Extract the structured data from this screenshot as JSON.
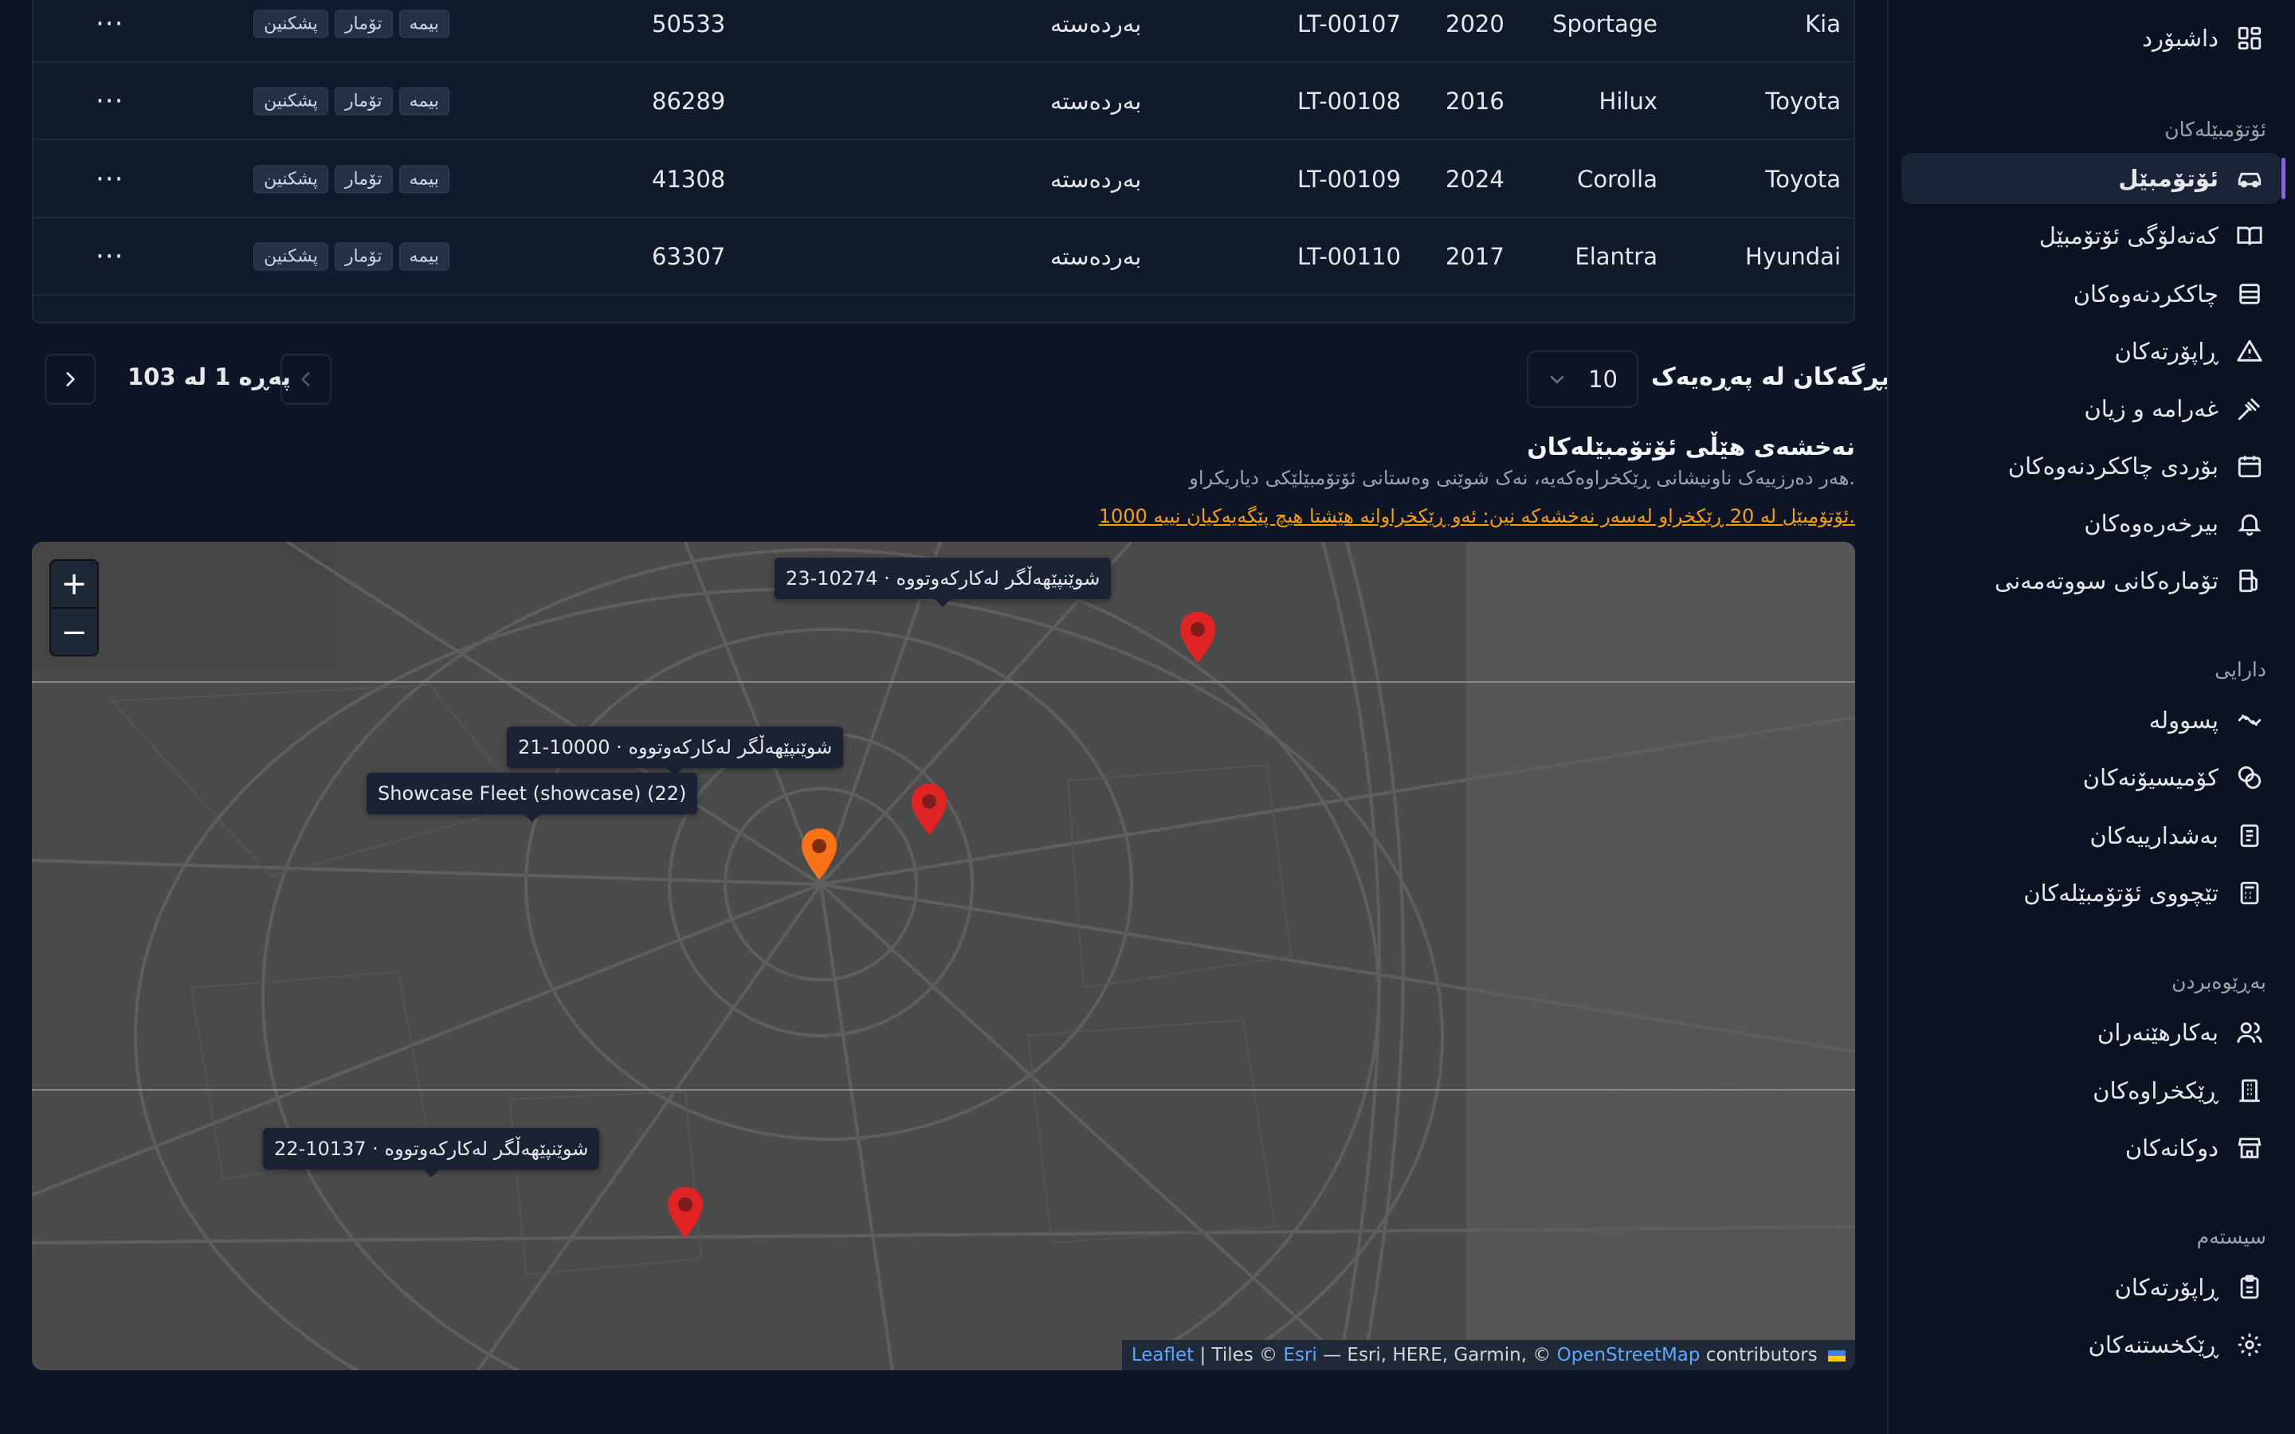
{
  "sidebar": {
    "dashboard": "داشبۆرد",
    "sections": {
      "vehicles": "ئۆتۆمبێلەکان",
      "finance": "دارایی",
      "management": "بەڕێوەبردن",
      "system": "سیستەم"
    },
    "vehicle_items": [
      {
        "label": "ئۆتۆمبێل",
        "icon": "car-icon",
        "active": true
      },
      {
        "label": "کەتەلۆگی ئۆتۆمبێل",
        "icon": "book-icon"
      },
      {
        "label": "چاککردنەوەکان",
        "icon": "wrench-icon"
      },
      {
        "label": "ڕاپۆرتەکان",
        "icon": "warning-icon"
      },
      {
        "label": "غەرامە و زیان",
        "icon": "gavel-icon"
      },
      {
        "label": "بۆردی چاککردنەوەکان",
        "icon": "calendar-icon"
      },
      {
        "label": "بیرخەرەوەکان",
        "icon": "bell-icon"
      },
      {
        "label": "تۆمارەکانی سووتەمەنی",
        "icon": "fuel-icon"
      }
    ],
    "finance_items": [
      {
        "label": "پسوولە",
        "icon": "receipt-icon"
      },
      {
        "label": "کۆمیسیۆنەکان",
        "icon": "coins-icon"
      },
      {
        "label": "بەشدارییەکان",
        "icon": "document-icon"
      },
      {
        "label": "تێچووی ئۆتۆمبێلەکان",
        "icon": "calculator-icon"
      }
    ],
    "management_items": [
      {
        "label": "بەکارهێنەران",
        "icon": "users-icon"
      },
      {
        "label": "ڕێکخراوەکان",
        "icon": "building-icon"
      },
      {
        "label": "دوکانەکان",
        "icon": "store-icon"
      }
    ],
    "system_items": [
      {
        "label": "ڕاپۆرتەکان",
        "icon": "clipboard-icon"
      },
      {
        "label": "ڕێکخستنەکان",
        "icon": "gear-icon"
      }
    ]
  },
  "table": {
    "rows": [
      {
        "make": "Kia",
        "model": "Sportage",
        "year": "2020",
        "plate": "LT-00107",
        "status": "بەردەستە",
        "mileage": "50533",
        "tags": [
          "بیمە",
          "تۆمار",
          "پشکنین"
        ]
      },
      {
        "make": "Toyota",
        "model": "Hilux",
        "year": "2016",
        "plate": "LT-00108",
        "status": "بەردەستە",
        "mileage": "86289",
        "tags": [
          "بیمە",
          "تۆمار",
          "پشکنین"
        ]
      },
      {
        "make": "Toyota",
        "model": "Corolla",
        "year": "2024",
        "plate": "LT-00109",
        "status": "بەردەستە",
        "mileage": "41308",
        "tags": [
          "بیمە",
          "تۆمار",
          "پشکنین"
        ]
      },
      {
        "make": "Hyundai",
        "model": "Elantra",
        "year": "2017",
        "plate": "LT-00110",
        "status": "بەردەستە",
        "mileage": "63307",
        "tags": [
          "بیمە",
          "تۆمار",
          "پشکنین"
        ]
      }
    ],
    "row_actions_label": "···"
  },
  "pagination": {
    "per_page_label": "بڕگەکان لە پەڕەیەک",
    "per_page_value": "10",
    "page_label": "پەڕە 1 لە 103"
  },
  "map_section": {
    "title": "نەخشەی هێڵی ئۆتۆمبێلەکان",
    "description": "هەر دەرزییەک ناونیشانی ڕێکخراوەکەیە، نەک شوێنی وەستانی ئۆتۆمبێلێکی دیاریکراو.",
    "warning": "1000 ئۆتۆمبێل لە 20 ڕێکخراو لەسەر نەخشەکە نین: ئەو ڕێکخراوانە هێشتا هیچ پێگەیەکیان نییە."
  },
  "map": {
    "zoom_in": "+",
    "zoom_out": "−",
    "tooltips": [
      "23-10274 · شوێنپێهەڵگر لەکارکەوتووە",
      "21-10000 · شوێنپێهەڵگر لەکارکەوتووە",
      "Showcase Fleet (showcase) (22)",
      "22-10137 · شوێنپێهەڵگر لەکارکەوتووە"
    ],
    "attribution": {
      "leaflet": "Leaflet",
      "tiles": " | Tiles © ",
      "esri": "Esri",
      "middle": " — Esri, HERE, Garmin, © ",
      "osm": "OpenStreetMap",
      "end": " contributors"
    }
  },
  "colors": {
    "accent": "#8b5cf6",
    "pin_red": "#e02424",
    "pin_orange": "#f97316",
    "warning": "#f59e0b",
    "link": "#60a5fa"
  }
}
